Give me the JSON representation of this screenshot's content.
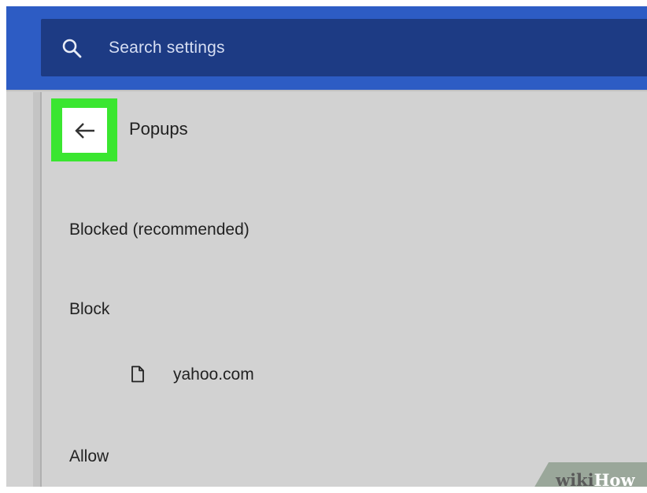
{
  "search": {
    "placeholder": "Search settings",
    "icon": "search-icon"
  },
  "header": {
    "title": "Popups",
    "back_icon": "back-arrow-icon"
  },
  "settings": {
    "default_option": "Blocked (recommended)",
    "block_section": {
      "label": "Block",
      "sites": [
        {
          "icon": "file-icon",
          "site": "yahoo.com"
        }
      ]
    },
    "allow_section": {
      "label": "Allow"
    }
  },
  "watermark": {
    "wiki": "wiki",
    "how": "How"
  },
  "colors": {
    "top_bar": "#2d5cc4",
    "search_box": "#1d3b84",
    "page_background": "#d2d2d2",
    "highlight": "#3ae630"
  }
}
